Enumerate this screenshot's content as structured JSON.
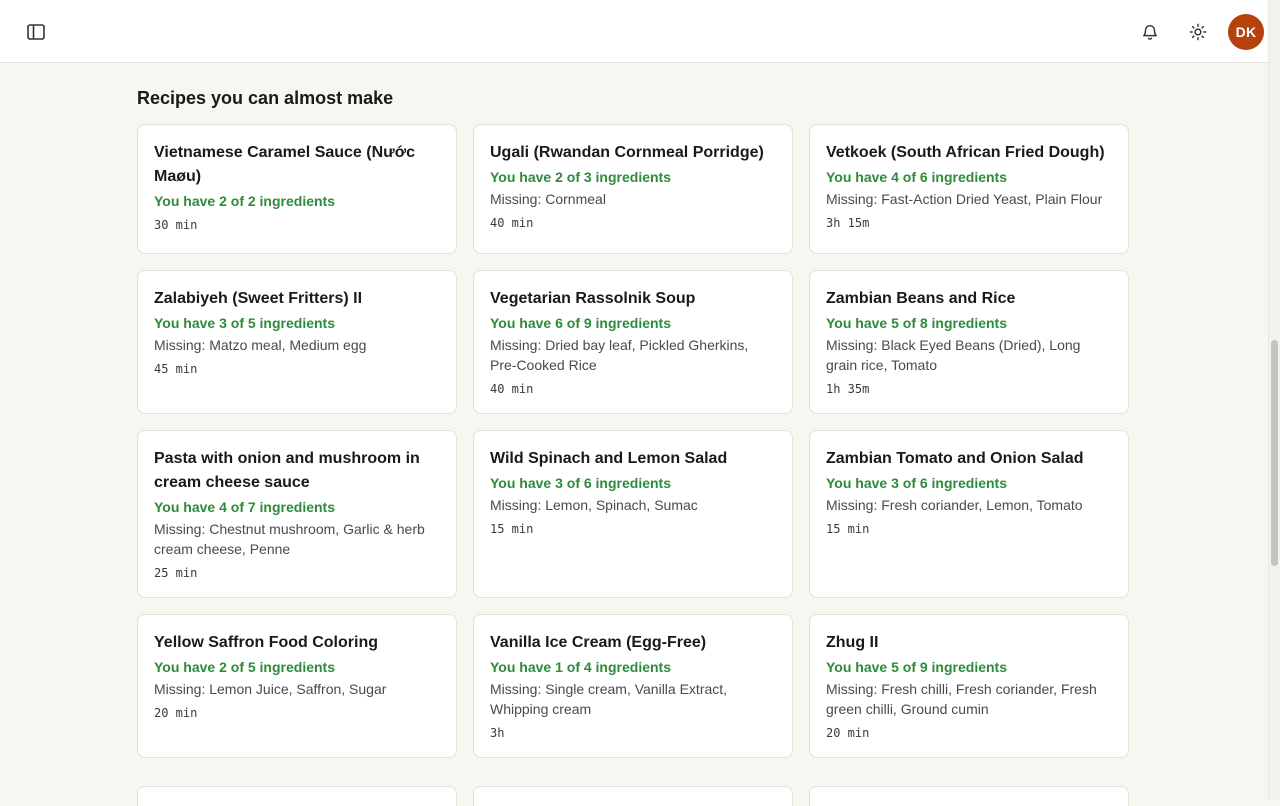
{
  "header": {
    "avatar_initials": "DK",
    "avatar_color": "#b5410d",
    "icons": {
      "sidebar": "sidebar-toggle-icon",
      "notifications": "bell-icon",
      "theme": "sun-icon"
    }
  },
  "section": {
    "title": "Recipes you can almost make"
  },
  "recipes": [
    {
      "title": "Vietnamese Caramel Sauce (Nước Maøu)",
      "have": "You have 2 of 2 ingredients",
      "missing": "",
      "time": "30 min"
    },
    {
      "title": "Ugali (Rwandan Cornmeal Porridge)",
      "have": "You have 2 of 3 ingredients",
      "missing": "Missing: Cornmeal",
      "time": "40 min"
    },
    {
      "title": "Vetkoek (South African Fried Dough)",
      "have": "You have 4 of 6 ingredients",
      "missing": "Missing: Fast-Action Dried Yeast, Plain Flour",
      "time": "3h 15m"
    },
    {
      "title": "Zalabiyeh (Sweet Fritters) II",
      "have": "You have 3 of 5 ingredients",
      "missing": "Missing: Matzo meal, Medium egg",
      "time": "45 min"
    },
    {
      "title": "Vegetarian Rassolnik Soup",
      "have": "You have 6 of 9 ingredients",
      "missing": "Missing: Dried bay leaf, Pickled Gherkins, Pre-Cooked Rice",
      "time": "40 min"
    },
    {
      "title": "Zambian Beans and Rice",
      "have": "You have 5 of 8 ingredients",
      "missing": "Missing: Black Eyed Beans (Dried), Long grain rice, Tomato",
      "time": "1h 35m"
    },
    {
      "title": "Pasta with onion and mushroom in cream cheese sauce",
      "have": "You have 4 of 7 ingredients",
      "missing": "Missing: Chestnut mushroom, Garlic & herb cream cheese, Penne",
      "time": "25 min"
    },
    {
      "title": "Wild Spinach and Lemon Salad",
      "have": "You have 3 of 6 ingredients",
      "missing": "Missing: Lemon, Spinach, Sumac",
      "time": "15 min"
    },
    {
      "title": "Zambian Tomato and Onion Salad",
      "have": "You have 3 of 6 ingredients",
      "missing": "Missing: Fresh coriander, Lemon, Tomato",
      "time": "15 min"
    },
    {
      "title": "Yellow Saffron Food Coloring",
      "have": "You have 2 of 5 ingredients",
      "missing": "Missing: Lemon Juice, Saffron, Sugar",
      "time": "20 min"
    },
    {
      "title": "Vanilla Ice Cream (Egg-Free)",
      "have": "You have 1 of 4 ingredients",
      "missing": "Missing: Single cream, Vanilla Extract, Whipping cream",
      "time": "3h"
    },
    {
      "title": "Zhug II",
      "have": "You have 5 of 9 ingredients",
      "missing": "Missing: Fresh chilli, Fresh coriander, Fresh green chilli, Ground cumin",
      "time": "20 min"
    }
  ],
  "colors": {
    "background": "#f8f6f0",
    "card": "#ffffff",
    "have_text": "#2e8b3a",
    "border": "#e3e0d8"
  }
}
